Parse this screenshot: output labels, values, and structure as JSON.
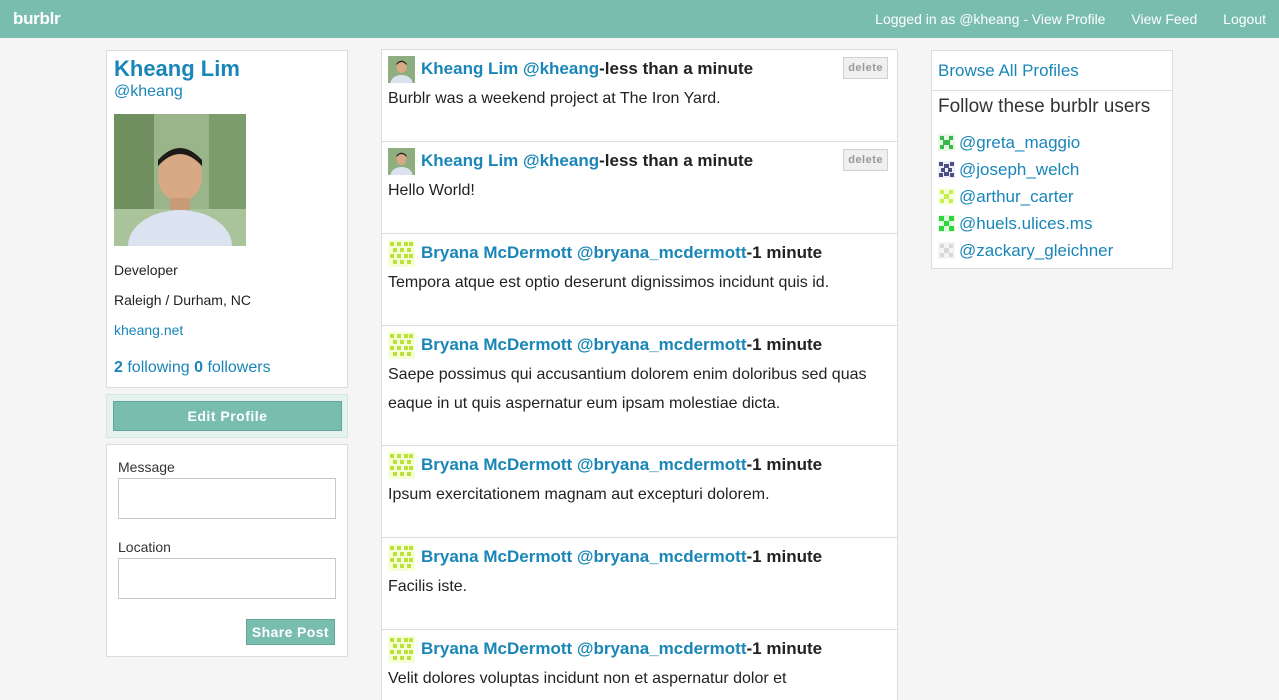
{
  "nav": {
    "brand": "burblr",
    "logged_in": "Logged in as @kheang - View Profile",
    "view_feed": "View Feed",
    "logout": "Logout"
  },
  "profile": {
    "name": "Kheang Lim",
    "handle": "@kheang",
    "title": "Developer",
    "location": "Raleigh / Durham, NC",
    "website": "kheang.net",
    "following_count": "2",
    "following_label": "following",
    "followers_count": "0",
    "followers_label": "followers",
    "edit_label": "Edit Profile"
  },
  "post_form": {
    "message_label": "Message",
    "message_value": "",
    "location_label": "Location",
    "location_value": "",
    "share_label": "Share Post"
  },
  "feed": {
    "delete_label": "delete",
    "posts": [
      {
        "name": "Kheang Lim @kheang",
        "sep": " - ",
        "time": "less than a minute",
        "body": "Burblr was a weekend project at The Iron Yard."
      },
      {
        "name": "Kheang Lim @kheang",
        "sep": " - ",
        "time": "less than a minute",
        "body": "Hello World!"
      },
      {
        "name": "Bryana McDermott @bryana_mcdermott",
        "sep": " - ",
        "time": "1 minute",
        "body": "Tempora atque est optio deserunt dignissimos incidunt quis id."
      },
      {
        "name": "Bryana McDermott @bryana_mcdermott",
        "sep": " - ",
        "time": "1 minute",
        "body": "Saepe possimus qui accusantium dolorem enim doloribus sed quas eaque in ut quis aspernatur eum ipsam molestiae dicta."
      },
      {
        "name": "Bryana McDermott @bryana_mcdermott",
        "sep": " - ",
        "time": "1 minute",
        "body": "Ipsum exercitationem magnam aut excepturi dolorem."
      },
      {
        "name": "Bryana McDermott @bryana_mcdermott",
        "sep": " - ",
        "time": "1 minute",
        "body": "Facilis iste."
      },
      {
        "name": "Bryana McDermott @bryana_mcdermott",
        "sep": " - ",
        "time": "1 minute",
        "body": "Velit dolores voluptas incidunt non et aspernatur dolor et"
      }
    ]
  },
  "sidebar": {
    "browse_label": "Browse All Profiles",
    "follow_heading": "Follow these burblr users",
    "users": [
      "@greta_maggio",
      "@joseph_welch",
      "@arthur_carter",
      "@huels.ulices.ms",
      "@zackary_gleichner"
    ]
  },
  "colors": {
    "accent": "#79bdaf",
    "link": "#1a86b8"
  }
}
